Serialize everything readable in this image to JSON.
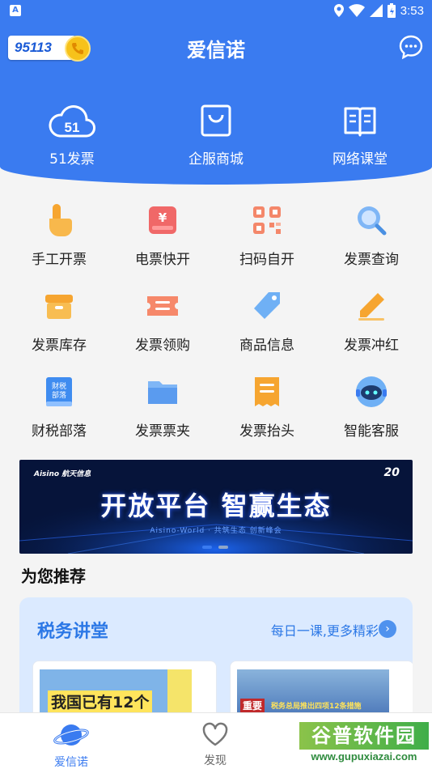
{
  "status_bar": {
    "left_icon": "A",
    "time": "3:53",
    "icons": [
      "location-icon",
      "wifi-icon",
      "signal-icon",
      "battery-icon"
    ]
  },
  "header": {
    "hotline": "95113",
    "title": "爱信诺",
    "message_icon": "chat-bubble-icon"
  },
  "top_nav": [
    {
      "label": "51发票",
      "icon": "cloud-51-icon"
    },
    {
      "label": "企服商城",
      "icon": "shopping-bag-icon"
    },
    {
      "label": "网络课堂",
      "icon": "open-book-icon"
    }
  ],
  "grid": [
    {
      "label": "手工开票",
      "icon": "hand-pointer-icon"
    },
    {
      "label": "电票快开",
      "icon": "yen-ticket-icon"
    },
    {
      "label": "扫码自开",
      "icon": "qr-code-icon"
    },
    {
      "label": "发票查询",
      "icon": "magnifier-icon"
    },
    {
      "label": "发票库存",
      "icon": "storage-box-icon"
    },
    {
      "label": "发票领购",
      "icon": "ticket-icon"
    },
    {
      "label": "商品信息",
      "icon": "price-tag-icon"
    },
    {
      "label": "发票冲红",
      "icon": "pencil-icon"
    },
    {
      "label": "财税部落",
      "icon": "tax-book-icon",
      "icon_text": "财税\n部落"
    },
    {
      "label": "发票票夹",
      "icon": "folder-icon"
    },
    {
      "label": "发票抬头",
      "icon": "receipt-header-icon"
    },
    {
      "label": "智能客服",
      "icon": "robot-service-icon"
    }
  ],
  "banner": {
    "logo": "Aisino 航天信息",
    "badge": "20",
    "headline": "开放平台  智赢生态",
    "subline": "Aisino-World · 共筑生态 创新峰会"
  },
  "recommend": {
    "title": "为您推荐"
  },
  "lecture": {
    "title": "税务讲堂",
    "more": "每日一课,更多精彩",
    "thumbs": [
      {
        "text": "我国已有12个"
      },
      {
        "tag": "重要",
        "text": "税务总局推出四项12条措施"
      }
    ]
  },
  "bottom_nav": [
    {
      "label": "爱信诺",
      "icon": "planet-icon",
      "active": true
    },
    {
      "label": "发现",
      "icon": "heart-icon",
      "active": false
    }
  ],
  "watermark": {
    "title": "谷普软件园",
    "url": "www.gupuxiazai.com"
  },
  "colors": {
    "primary": "#3a7bf0",
    "orange": "#f6a530",
    "red": "#f05a5a",
    "light_blue": "#dbeaff"
  }
}
